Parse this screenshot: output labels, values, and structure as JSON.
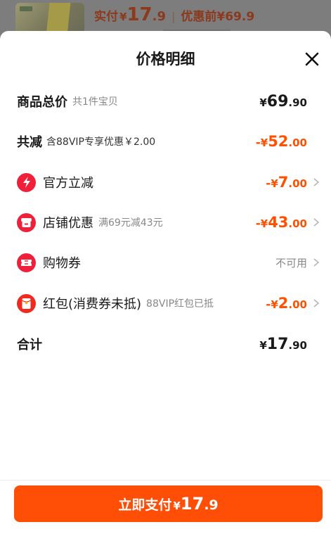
{
  "background": {
    "actual_pay_label": "实付",
    "currency": "¥",
    "actual_pay_int": "17",
    "actual_pay_dec": ".9",
    "separator": "|",
    "before_discount_label": "优惠前¥69.9"
  },
  "sheet": {
    "title": "价格明细",
    "close_icon": "close-icon"
  },
  "rows": {
    "total": {
      "label": "商品总价",
      "sub": "共1件宝贝",
      "currency": "¥",
      "int": "69",
      "dec": ".90"
    },
    "reduction": {
      "label": "共减",
      "sub": "含88VIP专享优惠￥2.00",
      "minus": "-",
      "currency": "¥",
      "int": "52",
      "dec": ".00"
    },
    "official": {
      "icon": "lightning-icon",
      "label": "官方立减",
      "minus": "-",
      "currency": "¥",
      "int": "7",
      "dec": ".00"
    },
    "store": {
      "icon": "store-icon",
      "label": "店铺优惠",
      "sub": "满69元减43元",
      "minus": "-",
      "currency": "¥",
      "int": "43",
      "dec": ".00"
    },
    "coupon": {
      "icon": "ticket-icon",
      "label": "购物券",
      "status": "不可用"
    },
    "redpacket": {
      "icon": "red-envelope-icon",
      "label": "红包(消费券未抵)",
      "sub": "88VIP红包已抵",
      "minus": "-",
      "currency": "¥",
      "int": "2",
      "dec": ".00"
    },
    "sum": {
      "label": "合计",
      "currency": "¥",
      "int": "17",
      "dec": ".90"
    }
  },
  "pay_button": {
    "label": "立即支付",
    "currency": "¥",
    "int": "17",
    "dec": ".9"
  },
  "colors": {
    "accent": "#ff5000",
    "button": "#ff4f06",
    "icon_red": "#f0203a"
  }
}
